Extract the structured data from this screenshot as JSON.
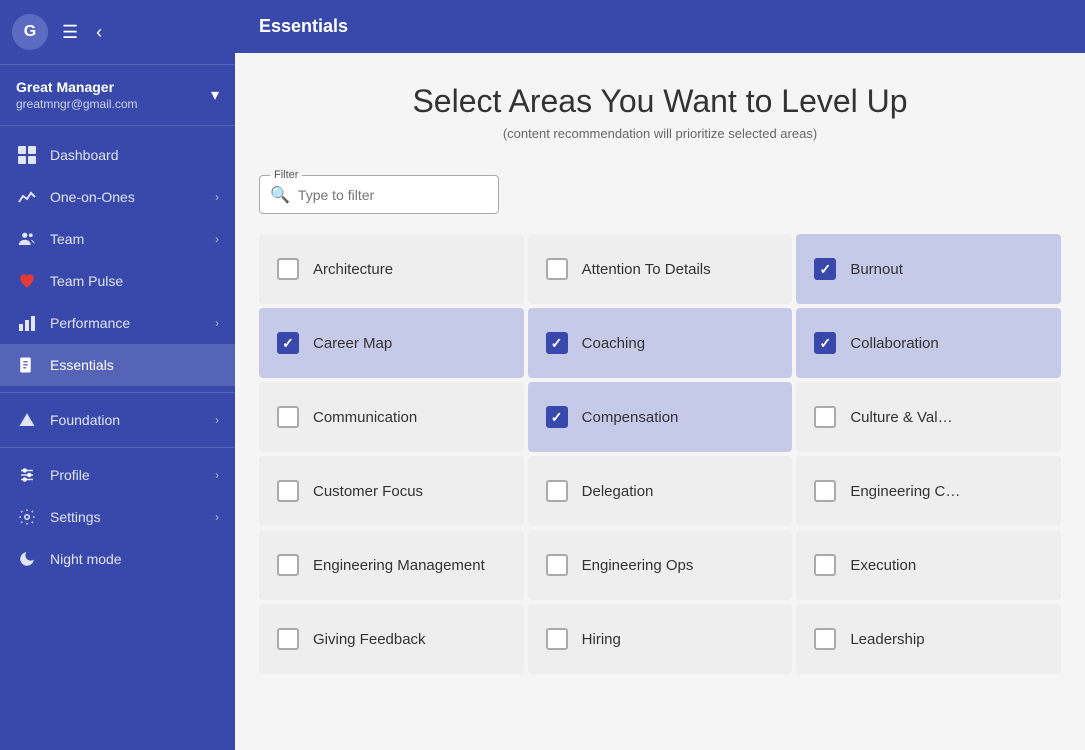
{
  "sidebar": {
    "avatar_letter": "G",
    "user_name": "Great Manager",
    "user_email": "greatmngr@gmail.com",
    "nav_items": [
      {
        "id": "dashboard",
        "label": "Dashboard",
        "icon": "grid",
        "has_arrow": false,
        "active": false
      },
      {
        "id": "one-on-ones",
        "label": "One-on-Ones",
        "icon": "timeline",
        "has_arrow": true,
        "active": false
      },
      {
        "id": "team",
        "label": "Team",
        "icon": "people",
        "has_arrow": true,
        "active": false
      },
      {
        "id": "team-pulse",
        "label": "Team Pulse",
        "icon": "heart",
        "has_arrow": false,
        "active": false
      },
      {
        "id": "performance",
        "label": "Performance",
        "icon": "bar-chart",
        "has_arrow": true,
        "active": false
      },
      {
        "id": "essentials",
        "label": "Essentials",
        "icon": "book",
        "has_arrow": false,
        "active": true
      }
    ],
    "bottom_items": [
      {
        "id": "foundation",
        "label": "Foundation",
        "icon": "mountain",
        "has_arrow": true
      },
      {
        "id": "profile",
        "label": "Profile",
        "icon": "sliders",
        "has_arrow": true
      },
      {
        "id": "settings",
        "label": "Settings",
        "icon": "gear",
        "has_arrow": true
      },
      {
        "id": "night-mode",
        "label": "Night mode",
        "icon": "moon",
        "has_arrow": false
      }
    ]
  },
  "topbar": {
    "title": "Essentials"
  },
  "main": {
    "heading": "Select Areas You Want to Level Up",
    "subheading": "(content recommendation will prioritize selected areas)",
    "filter_label": "Filter",
    "filter_placeholder": "Type to filter",
    "areas": [
      {
        "id": "architecture",
        "label": "Architecture",
        "selected": false
      },
      {
        "id": "attention-to-details",
        "label": "Attention To Details",
        "selected": false
      },
      {
        "id": "burnout",
        "label": "Burnout",
        "selected": true
      },
      {
        "id": "career-map",
        "label": "Career Map",
        "selected": true
      },
      {
        "id": "coaching",
        "label": "Coaching",
        "selected": true
      },
      {
        "id": "collaboration",
        "label": "Collaboration",
        "selected": true
      },
      {
        "id": "communication",
        "label": "Communication",
        "selected": false
      },
      {
        "id": "compensation",
        "label": "Compensation",
        "selected": true
      },
      {
        "id": "culture-values",
        "label": "Culture & Val…",
        "selected": false
      },
      {
        "id": "customer-focus",
        "label": "Customer Focus",
        "selected": false
      },
      {
        "id": "delegation",
        "label": "Delegation",
        "selected": false
      },
      {
        "id": "engineering-culture",
        "label": "Engineering C…",
        "selected": false
      },
      {
        "id": "engineering-management",
        "label": "Engineering Management",
        "selected": false
      },
      {
        "id": "engineering-ops",
        "label": "Engineering Ops",
        "selected": false
      },
      {
        "id": "execution",
        "label": "Execution",
        "selected": false
      },
      {
        "id": "giving-feedback",
        "label": "Giving Feedback",
        "selected": false
      },
      {
        "id": "hiring",
        "label": "Hiring",
        "selected": false
      },
      {
        "id": "leadership",
        "label": "Leadership",
        "selected": false
      }
    ]
  }
}
